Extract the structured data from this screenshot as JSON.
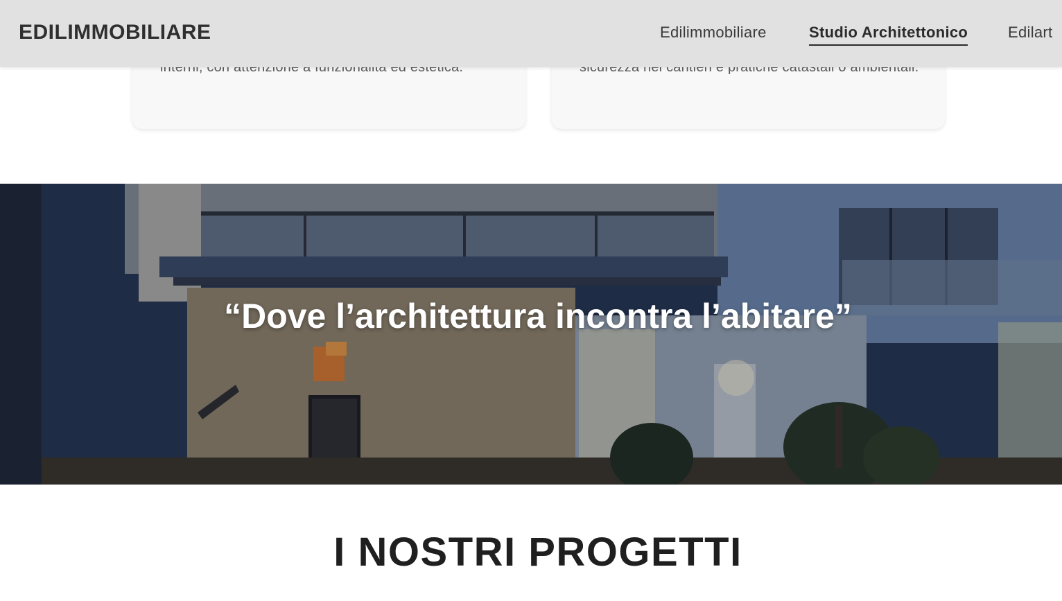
{
  "header": {
    "brand": "EDILIMMOBILIARE",
    "nav": [
      {
        "label": "Edilimmobiliare"
      },
      {
        "label": "Studio Architettonico",
        "active": true
      },
      {
        "label": "Edilart"
      }
    ]
  },
  "services": {
    "left_card_text": "interni, con attenzione a funzionalità ed estetica.",
    "right_card_text": "sicurezza nei cantieri e pratiche catastali o ambientali."
  },
  "hero": {
    "quote": "“Dove l’architettura incontra l’abitare”",
    "image": "modern-villa-night-photo"
  },
  "projects": {
    "title": "I NOSTRI PROGETTI"
  },
  "colors": {
    "header_bg": "#e1e1e1",
    "card_bg": "#f8f8f8",
    "hero_sky": "#1d2a44",
    "text_dark": "#1f1f1f"
  }
}
